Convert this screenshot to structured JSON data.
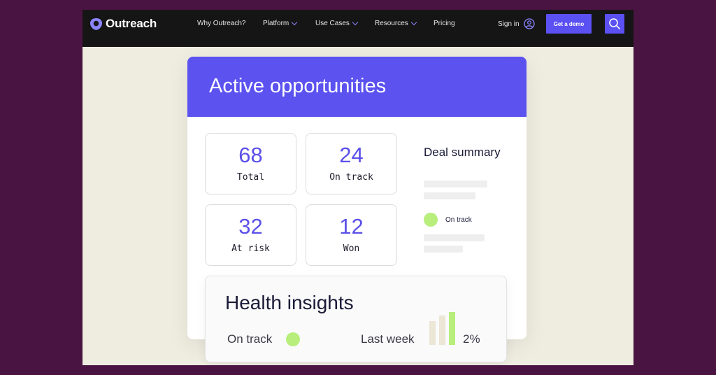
{
  "nav": {
    "logo_text": "Outreach",
    "items": [
      {
        "label": "Why Outreach?",
        "has_dropdown": false
      },
      {
        "label": "Platform",
        "has_dropdown": true
      },
      {
        "label": "Use Cases",
        "has_dropdown": true
      },
      {
        "label": "Resources",
        "has_dropdown": true
      },
      {
        "label": "Pricing",
        "has_dropdown": false
      }
    ],
    "signin_label": "Sign in",
    "demo_label": "Get a demo"
  },
  "card": {
    "title": "Active opportunities",
    "stats": [
      {
        "value": "68",
        "label": "Total"
      },
      {
        "value": "24",
        "label": "On track"
      },
      {
        "value": "32",
        "label": "At risk"
      },
      {
        "value": "12",
        "label": "Won"
      }
    ],
    "deal_summary": {
      "title": "Deal summary",
      "status_label": "On track"
    }
  },
  "health": {
    "title": "Health insights",
    "status_label": "On track",
    "period_label": "Last week",
    "percent": "2%"
  },
  "colors": {
    "brand": "#5b50f2",
    "nav_bg": "#151515",
    "outer_bg": "#4a1442",
    "page_bg": "#efece0",
    "success": "#b8ee7c"
  },
  "icons": {
    "logo": "outreach-shield-logo",
    "user": "user-circle-icon",
    "search": "search-icon",
    "dropdown": "chevron-down-icon",
    "status": "green-dot-icon"
  }
}
